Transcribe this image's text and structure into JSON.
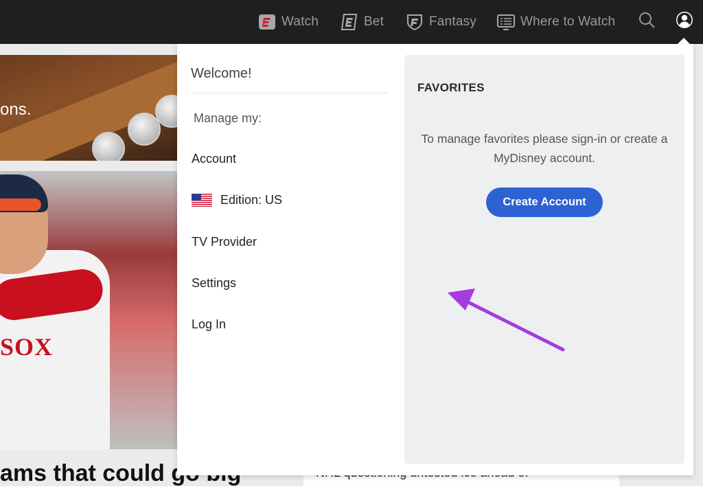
{
  "topnav": {
    "items": [
      {
        "label": "Watch",
        "icon": "espn-watch-icon"
      },
      {
        "label": "Bet",
        "icon": "espn-bet-icon"
      },
      {
        "label": "Fantasy",
        "icon": "fantasy-shield-icon"
      },
      {
        "label": "Where to Watch",
        "icon": "tv-guide-icon"
      }
    ],
    "search_icon": "search-icon",
    "profile_icon": "user-profile-icon",
    "background": "#1f1f1f"
  },
  "background_content": {
    "story1_caption": "ons.",
    "story2_jersey_text": "SOX",
    "headline": "ams that could go big",
    "side_story": "NHL questioning untested ice ahead of"
  },
  "dropdown": {
    "welcome": "Welcome!",
    "manage_label": "Manage my:",
    "menu": [
      {
        "label": "Account"
      },
      {
        "label": "Edition: US",
        "icon": "us-flag-icon"
      },
      {
        "label": "TV Provider"
      },
      {
        "label": "Settings"
      },
      {
        "label": "Log In"
      }
    ],
    "favorites": {
      "title": "FAVORITES",
      "message": "To manage favorites please sign-in or create a MyDisney account.",
      "button_label": "Create Account"
    }
  },
  "annotation": {
    "arrow_color": "#a63be0"
  },
  "colors": {
    "accent": "#2c62d3",
    "panel": "#eeeff0"
  }
}
